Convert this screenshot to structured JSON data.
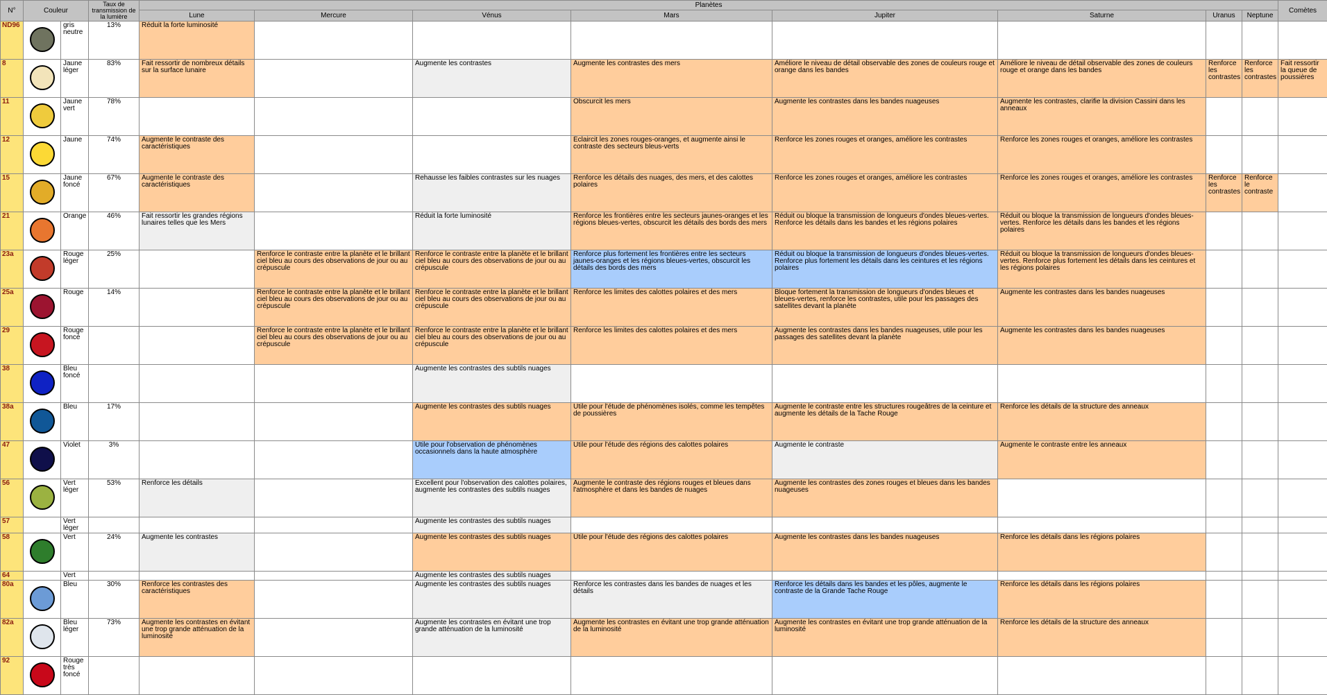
{
  "header": {
    "num": "N°",
    "couleur": "Couleur",
    "taux": "Taux de transmission de la lumière",
    "planetes": "Planètes",
    "cometes": "Comètes",
    "planet_names": [
      "Lune",
      "Mercure",
      "Vénus",
      "Mars",
      "Jupiter",
      "Saturne",
      "Uranus",
      "Neptune"
    ]
  },
  "colors": {
    "cell_orange": "#ffcd9c",
    "cell_grey": "#efefef",
    "cell_blue": "#a9cdfc",
    "number_column": "#fde47a",
    "header": "#c3c3c3"
  },
  "rows": [
    {
      "num": "ND96",
      "swatch": "#6f735f",
      "color_name": "gris neutre",
      "trans": "13%",
      "cells": [
        {
          "t": "Réduit la forte luminosité",
          "c": "o"
        },
        {
          "t": "",
          "c": ""
        },
        {
          "t": "",
          "c": ""
        },
        {
          "t": "",
          "c": ""
        },
        {
          "t": "",
          "c": ""
        },
        {
          "t": "",
          "c": ""
        },
        {
          "t": "",
          "c": ""
        },
        {
          "t": "",
          "c": ""
        },
        {
          "t": "",
          "c": ""
        }
      ]
    },
    {
      "num": "8",
      "swatch": "#f2e4ba",
      "color_name": "Jaune léger",
      "trans": "83%",
      "cells": [
        {
          "t": "Fait ressortir de nombreux détails sur la surface lunaire",
          "c": "o"
        },
        {
          "t": "",
          "c": ""
        },
        {
          "t": "Augmente les contrastes",
          "c": "g"
        },
        {
          "t": "Augmente les contrastes des mers",
          "c": "o"
        },
        {
          "t": "Améliore le niveau de détail observable des zones de couleurs rouge et orange dans les bandes",
          "c": "o"
        },
        {
          "t": "Améliore le niveau de détail observable des zones de couleurs rouge et orange dans les bandes",
          "c": "o"
        },
        {
          "t": "Renforce les contrastes",
          "c": "o"
        },
        {
          "t": "Renforce les contrastes",
          "c": "o"
        },
        {
          "t": "Fait ressortir la queue de poussières",
          "c": "o"
        }
      ]
    },
    {
      "num": "11",
      "swatch": "#efcb3d",
      "color_name": "Jaune vert",
      "trans": "78%",
      "cells": [
        {
          "t": "",
          "c": ""
        },
        {
          "t": "",
          "c": ""
        },
        {
          "t": "",
          "c": ""
        },
        {
          "t": "Obscurcit les mers",
          "c": "o"
        },
        {
          "t": "Augmente les contrastes dans les bandes nuageuses",
          "c": "o"
        },
        {
          "t": "Augmente les contrastes, clarifie la division Cassini dans les anneaux",
          "c": "o"
        },
        {
          "t": "",
          "c": ""
        },
        {
          "t": "",
          "c": ""
        },
        {
          "t": "",
          "c": ""
        }
      ]
    },
    {
      "num": "12",
      "swatch": "#fcd935",
      "color_name": "Jaune",
      "trans": "74%",
      "cells": [
        {
          "t": "Augmente le contraste des caractéristiques",
          "c": "o"
        },
        {
          "t": "",
          "c": ""
        },
        {
          "t": "",
          "c": ""
        },
        {
          "t": "Éclaircit les zones rouges-oranges, et augmente ainsi le contraste des secteurs bleus-verts",
          "c": "o"
        },
        {
          "t": "Renforce les zones rouges et oranges, améliore les contrastes",
          "c": "o"
        },
        {
          "t": "Renforce les zones rouges et oranges, améliore les contrastes",
          "c": "o"
        },
        {
          "t": "",
          "c": ""
        },
        {
          "t": "",
          "c": ""
        },
        {
          "t": "",
          "c": ""
        }
      ]
    },
    {
      "num": "15",
      "swatch": "#e2ac28",
      "color_name": "Jaune foncé",
      "trans": "67%",
      "cells": [
        {
          "t": "Augmente le contraste des caractéristiques",
          "c": "o"
        },
        {
          "t": "",
          "c": ""
        },
        {
          "t": "Rehausse les faibles contrastes sur les nuages",
          "c": "g"
        },
        {
          "t": "Renforce les détails des nuages, des mers, et des calottes polaires",
          "c": "o"
        },
        {
          "t": "Renforce les zones rouges et oranges, améliore les contrastes",
          "c": "o"
        },
        {
          "t": "Renforce les zones rouges et oranges, améliore les contrastes",
          "c": "o"
        },
        {
          "t": "Renforce les contrastes",
          "c": "o"
        },
        {
          "t": "Renforce le contraste",
          "c": "o"
        },
        {
          "t": "",
          "c": ""
        }
      ]
    },
    {
      "num": "21",
      "swatch": "#e8762f",
      "color_name": "Orange",
      "trans": "46%",
      "cells": [
        {
          "t": "Fait ressortir les grandes régions lunaires telles que les Mers",
          "c": "g"
        },
        {
          "t": "",
          "c": ""
        },
        {
          "t": "Réduit la forte luminosité",
          "c": "g"
        },
        {
          "t": "Renforce les frontières entre les secteurs jaunes-oranges et les régions bleues-vertes, obscurcit les détails des bords des mers",
          "c": "o"
        },
        {
          "t": "Réduit ou bloque la transmission de longueurs d'ondes bleues-vertes. Renforce les détails dans les bandes et les régions polaires",
          "c": "o"
        },
        {
          "t": "Réduit ou bloque la transmission de longueurs d'ondes bleues-vertes. Renforce les détails dans les bandes et les régions polaires",
          "c": "o"
        },
        {
          "t": "",
          "c": ""
        },
        {
          "t": "",
          "c": ""
        },
        {
          "t": "",
          "c": ""
        }
      ]
    },
    {
      "num": "23a",
      "swatch": "#c23b2a",
      "color_name": "Rouge léger",
      "trans": "25%",
      "cells": [
        {
          "t": "",
          "c": ""
        },
        {
          "t": "Renforce le contraste entre la planète et le brillant ciel bleu au cours des observations de jour ou au crépuscule",
          "c": "o"
        },
        {
          "t": "Renforce le contraste entre la planète et le brillant ciel bleu au cours des observations de jour ou au crépuscule",
          "c": "o"
        },
        {
          "t": "Renforce plus fortement les frontières entre les secteurs jaunes-oranges et les régions bleues-vertes, obscurcit les détails des bords des mers",
          "c": "b"
        },
        {
          "t": "Réduit ou bloque la transmission de longueurs d'ondes bleues-vertes. Renforce plus fortement les détails dans les ceintures et les régions polaires",
          "c": "b"
        },
        {
          "t": "Réduit ou bloque la transmission de longueurs d'ondes bleues-vertes. Renforce plus fortement les détails dans les ceintures et les régions polaires",
          "c": "o"
        },
        {
          "t": "",
          "c": ""
        },
        {
          "t": "",
          "c": ""
        },
        {
          "t": "",
          "c": ""
        }
      ]
    },
    {
      "num": "25a",
      "swatch": "#9c1430",
      "color_name": "Rouge",
      "trans": "14%",
      "cells": [
        {
          "t": "",
          "c": ""
        },
        {
          "t": "Renforce le contraste entre la planète et le brillant ciel bleu au cours des observations de jour ou au crépuscule",
          "c": "o"
        },
        {
          "t": "Renforce le contraste entre la planète et le brillant ciel bleu au cours des observations de jour ou au crépuscule",
          "c": "o"
        },
        {
          "t": "Renforce les limites des calottes polaires et des mers",
          "c": "o"
        },
        {
          "t": "Bloque fortement la transmission de longueurs d'ondes bleues et bleues-vertes, renforce les contrastes, utile pour les passages des satellites devant la planète",
          "c": "o"
        },
        {
          "t": "Augmente les contrastes dans les bandes nuageuses",
          "c": "o"
        },
        {
          "t": "",
          "c": ""
        },
        {
          "t": "",
          "c": ""
        },
        {
          "t": "",
          "c": ""
        }
      ]
    },
    {
      "num": "29",
      "swatch": "#c71520",
      "color_name": "Rouge foncé",
      "trans": "",
      "cells": [
        {
          "t": "",
          "c": ""
        },
        {
          "t": "Renforce le contraste entre la planète et le brillant ciel bleu au cours des observations de jour ou au crépuscule",
          "c": "o"
        },
        {
          "t": "Renforce le contraste entre la planète et le brillant ciel bleu au cours des observations de jour ou au crépuscule",
          "c": "o"
        },
        {
          "t": "Renforce les limites des calottes polaires et des mers",
          "c": "o"
        },
        {
          "t": "Augmente les contrastes dans les bandes nuageuses, utile pour les passages des satellites devant la planète",
          "c": "o"
        },
        {
          "t": "Augmente les contrastes dans les bandes nuageuses",
          "c": "o"
        },
        {
          "t": "",
          "c": ""
        },
        {
          "t": "",
          "c": ""
        },
        {
          "t": "",
          "c": ""
        }
      ]
    },
    {
      "num": "38",
      "swatch": "#0f22c4",
      "color_name": "Bleu foncé",
      "trans": "",
      "cells": [
        {
          "t": "",
          "c": ""
        },
        {
          "t": "",
          "c": ""
        },
        {
          "t": "Augmente les contrastes des subtils nuages",
          "c": "g"
        },
        {
          "t": "",
          "c": ""
        },
        {
          "t": "",
          "c": ""
        },
        {
          "t": "",
          "c": ""
        },
        {
          "t": "",
          "c": ""
        },
        {
          "t": "",
          "c": ""
        },
        {
          "t": "",
          "c": ""
        }
      ]
    },
    {
      "num": "38a",
      "swatch": "#105797",
      "color_name": "Bleu",
      "trans": "17%",
      "cells": [
        {
          "t": "",
          "c": ""
        },
        {
          "t": "",
          "c": ""
        },
        {
          "t": "Augmente les contrastes des subtils nuages",
          "c": "o"
        },
        {
          "t": "Utile pour l'étude de phénomènes isolés, comme les tempêtes de poussières",
          "c": "o"
        },
        {
          "t": "Augmente le contraste entre les structures rougeâtres de la ceinture et augmente les détails de la Tache Rouge",
          "c": "o"
        },
        {
          "t": "Renforce les détails de la structure des anneaux",
          "c": "o"
        },
        {
          "t": "",
          "c": ""
        },
        {
          "t": "",
          "c": ""
        },
        {
          "t": "",
          "c": ""
        }
      ]
    },
    {
      "num": "47",
      "swatch": "#0f0f4a",
      "color_name": "Violet",
      "trans": "3%",
      "cells": [
        {
          "t": "",
          "c": ""
        },
        {
          "t": "",
          "c": ""
        },
        {
          "t": "Utile pour l'observation de phénomènes occasionnels dans la haute atmosphère",
          "c": "b"
        },
        {
          "t": "Utile pour l'étude des régions des calottes polaires",
          "c": "o"
        },
        {
          "t": "Augmente le contraste",
          "c": "g"
        },
        {
          "t": "Augmente le contraste entre les anneaux",
          "c": "o"
        },
        {
          "t": "",
          "c": ""
        },
        {
          "t": "",
          "c": ""
        },
        {
          "t": "",
          "c": ""
        }
      ]
    },
    {
      "num": "56",
      "swatch": "#9bb241",
      "color_name": "Vert léger",
      "trans": "53%",
      "cells": [
        {
          "t": "Renforce les détails",
          "c": "g"
        },
        {
          "t": "",
          "c": ""
        },
        {
          "t": "Excellent pour l'observation des calottes polaires, augmente les contrastes des subtils nuages",
          "c": "g"
        },
        {
          "t": "Augmente le contraste des régions rouges et bleues dans l'atmosphère et dans les bandes de nuages",
          "c": "o"
        },
        {
          "t": "Augmente les contrastes des zones rouges et bleues dans les bandes nuageuses",
          "c": "o"
        },
        {
          "t": "",
          "c": ""
        },
        {
          "t": "",
          "c": ""
        },
        {
          "t": "",
          "c": ""
        },
        {
          "t": "",
          "c": ""
        }
      ]
    },
    {
      "num": "57",
      "swatch": "",
      "color_name": "Vert léger",
      "trans": "",
      "cells": [
        {
          "t": "",
          "c": ""
        },
        {
          "t": "",
          "c": ""
        },
        {
          "t": "Augmente les contrastes des subtils nuages",
          "c": "g"
        },
        {
          "t": "",
          "c": ""
        },
        {
          "t": "",
          "c": ""
        },
        {
          "t": "",
          "c": ""
        },
        {
          "t": "",
          "c": ""
        },
        {
          "t": "",
          "c": ""
        },
        {
          "t": "",
          "c": ""
        }
      ]
    },
    {
      "num": "58",
      "swatch": "#2e7d2c",
      "color_name": "Vert",
      "trans": "24%",
      "cells": [
        {
          "t": "Augmente les contrastes",
          "c": "g"
        },
        {
          "t": "",
          "c": ""
        },
        {
          "t": "Augmente les contrastes des subtils nuages",
          "c": "o"
        },
        {
          "t": "Utile pour l'étude des régions des calottes polaires",
          "c": "o"
        },
        {
          "t": "Augmente les contrastes dans les bandes nuageuses",
          "c": "o"
        },
        {
          "t": "Renforce les détails dans les régions polaires",
          "c": "o"
        },
        {
          "t": "",
          "c": ""
        },
        {
          "t": "",
          "c": ""
        },
        {
          "t": "",
          "c": ""
        }
      ]
    },
    {
      "num": "64",
      "swatch": "",
      "color_name": "Vert",
      "trans": "",
      "cells": [
        {
          "t": "",
          "c": ""
        },
        {
          "t": "",
          "c": ""
        },
        {
          "t": "Augmente les contrastes des subtils nuages",
          "c": "g"
        },
        {
          "t": "",
          "c": ""
        },
        {
          "t": "",
          "c": ""
        },
        {
          "t": "",
          "c": ""
        },
        {
          "t": "",
          "c": ""
        },
        {
          "t": "",
          "c": ""
        },
        {
          "t": "",
          "c": ""
        }
      ]
    },
    {
      "num": "80a",
      "swatch": "#6c9bd6",
      "color_name": "Bleu",
      "trans": "30%",
      "cells": [
        {
          "t": "Renforce les contrastes des caractéristiques",
          "c": "o"
        },
        {
          "t": "",
          "c": ""
        },
        {
          "t": "Augmente les contrastes des subtils nuages",
          "c": "g"
        },
        {
          "t": "Renforce les contrastes dans les bandes de nuages et les détails",
          "c": "g"
        },
        {
          "t": "Renforce les détails dans les bandes et les pôles, augmente le contraste de la Grande Tache Rouge",
          "c": "b"
        },
        {
          "t": "Renforce les détails dans les régions polaires",
          "c": "o"
        },
        {
          "t": "",
          "c": ""
        },
        {
          "t": "",
          "c": ""
        },
        {
          "t": "",
          "c": ""
        }
      ]
    },
    {
      "num": "82a",
      "swatch": "#dfe5ec",
      "color_name": "Bleu léger",
      "trans": "73%",
      "cells": [
        {
          "t": "Augmente les contrastes en évitant une trop grande atténuation de la luminosité",
          "c": "o"
        },
        {
          "t": "",
          "c": ""
        },
        {
          "t": "Augmente les contrastes en évitant une trop grande atténuation de la luminosité",
          "c": "g"
        },
        {
          "t": "Augmente les contrastes en évitant une trop grande atténuation de la luminosité",
          "c": "o"
        },
        {
          "t": "Augmente les contrastes en évitant une trop grande atténuation de la luminosité",
          "c": "o"
        },
        {
          "t": "Renforce les détails de la structure des anneaux",
          "c": "o"
        },
        {
          "t": "",
          "c": ""
        },
        {
          "t": "",
          "c": ""
        },
        {
          "t": "",
          "c": ""
        }
      ]
    },
    {
      "num": "92",
      "swatch": "#c8081a",
      "color_name": "Rouge très foncé",
      "trans": "",
      "cells": [
        {
          "t": "",
          "c": ""
        },
        {
          "t": "",
          "c": ""
        },
        {
          "t": "",
          "c": ""
        },
        {
          "t": "",
          "c": ""
        },
        {
          "t": "",
          "c": ""
        },
        {
          "t": "",
          "c": ""
        },
        {
          "t": "",
          "c": ""
        },
        {
          "t": "",
          "c": ""
        },
        {
          "t": "",
          "c": ""
        }
      ]
    }
  ]
}
